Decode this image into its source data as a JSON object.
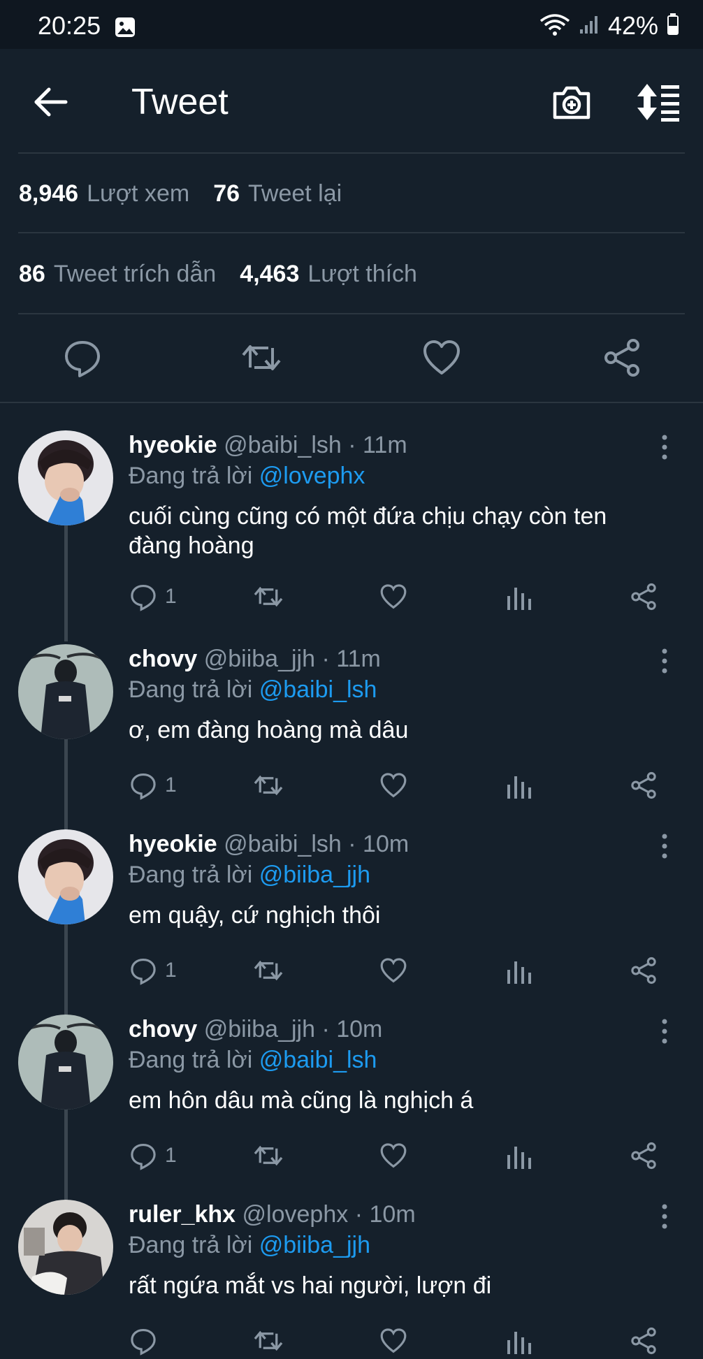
{
  "status_bar": {
    "time": "20:25",
    "battery": "42%"
  },
  "header": {
    "title": "Tweet"
  },
  "stats": {
    "views_count": "8,946",
    "views_label": "Lượt xem",
    "retweets_count": "76",
    "retweets_label": "Tweet lại",
    "quotes_count": "86",
    "quotes_label": "Tweet trích dẫn",
    "likes_count": "4,463",
    "likes_label": "Lượt thích"
  },
  "replies": [
    {
      "name": "hyeokie",
      "handle": "@baibi_lsh",
      "time": "11m",
      "replying_label": "Đang trả lời",
      "mention": "@lovephx",
      "text": "cuối cùng cũng có một đứa chịu chạy còn ten đàng hoàng",
      "reply_count": "1",
      "avatar": "hyeokie"
    },
    {
      "name": "chovy",
      "handle": "@biiba_jjh",
      "time": "11m",
      "replying_label": "Đang trả lời",
      "mention": "@baibi_lsh",
      "text": "ơ, em đàng hoàng mà dâu",
      "reply_count": "1",
      "avatar": "chovy"
    },
    {
      "name": "hyeokie",
      "handle": "@baibi_lsh",
      "time": "10m",
      "replying_label": "Đang trả lời",
      "mention": "@biiba_jjh",
      "text": "em quậy, cứ nghịch thôi",
      "reply_count": "1",
      "avatar": "hyeokie"
    },
    {
      "name": "chovy",
      "handle": "@biiba_jjh",
      "time": "10m",
      "replying_label": "Đang trả lời",
      "mention": "@baibi_lsh",
      "text": "em hôn dâu mà cũng là nghịch á",
      "reply_count": "1",
      "avatar": "chovy"
    },
    {
      "name": "ruler_khx",
      "handle": "@lovephx",
      "time": "10m",
      "replying_label": "Đang trả lời",
      "mention": "@biiba_jjh",
      "text": "rất ngứa mắt vs hai người, lượn đi",
      "reply_count": "",
      "avatar": "ruler"
    }
  ],
  "icons": {
    "back": "arrow-left-icon",
    "camera": "camera-plus-icon",
    "sort": "sort-icon",
    "reply": "comment-icon",
    "retweet": "retweet-icon",
    "like": "heart-icon",
    "analytics": "bar-chart-icon",
    "share": "share-icon",
    "more": "more-vertical-icon"
  },
  "colors": {
    "background": "#15202b",
    "accent": "#1d9bf0",
    "muted": "#8b98a5"
  }
}
